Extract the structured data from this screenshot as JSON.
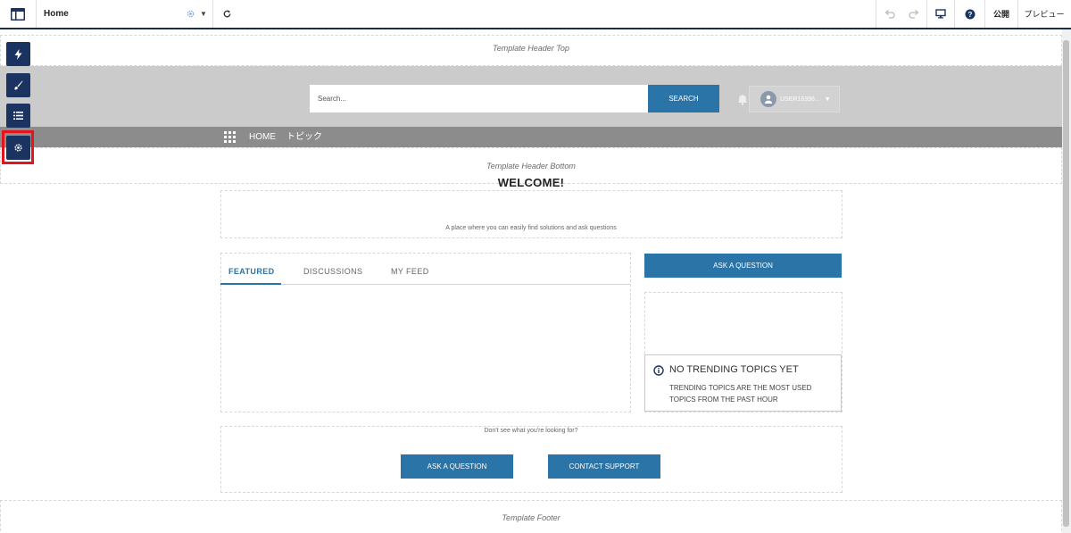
{
  "toolbar": {
    "page_name": "Home",
    "publish_label": "公開",
    "preview_label": "プレビュー"
  },
  "palette": {
    "items": [
      {
        "icon": "lightning-icon"
      },
      {
        "icon": "brush-icon"
      },
      {
        "icon": "list-icon"
      },
      {
        "icon": "gear-icon"
      }
    ]
  },
  "canvas": {
    "header_top_label": "Template Header Top",
    "search_placeholder": "Search...",
    "search_button": "SEARCH",
    "user_name": "USER16396...",
    "nav_items": [
      "HOME",
      "トピック"
    ],
    "header_bottom_label": "Template Header Bottom",
    "welcome_title": "WELCOME!",
    "welcome_subtitle": "A place where you can easily find solutions and ask questions",
    "tabs": [
      "FEATURED",
      "DISCUSSIONS",
      "MY FEED"
    ],
    "ask_question_top": "ASK A QUESTION",
    "trending_title": "NO TRENDING TOPICS YET",
    "trending_desc": "TRENDING TOPICS ARE THE MOST USED TOPICS FROM THE PAST HOUR",
    "help_prompt": "Don't see what you're looking for?",
    "ask_question_bottom": "ASK A QUESTION",
    "contact_support": "CONTACT SUPPORT",
    "footer_label": "Template Footer"
  },
  "colors": {
    "accent": "#2b74a8",
    "palette_bg": "#1b3360",
    "highlight": "#e3141d"
  }
}
